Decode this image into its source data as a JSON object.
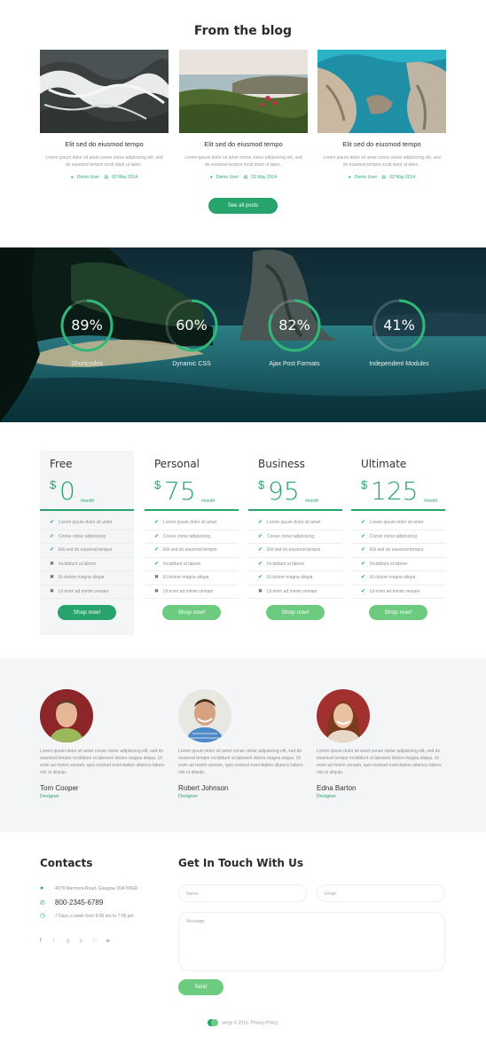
{
  "blog": {
    "title": "From the blog",
    "posts": [
      {
        "title": "Elit sed do eiusmod tempo",
        "text": "Lorem ipsum dolor sit amet conse ctetur adipisicing elit, sed do eiusmod tempor incid idunt ut labor..",
        "author": "Demo User",
        "date": "02 May 2014"
      },
      {
        "title": "Elit sed do eiusmod tempo",
        "text": "Lorem ipsum dolor sit amet conse ctetur adipisicing elit, sed do eiusmod tempor incid idunt ut labor..",
        "author": "Demo User",
        "date": "02 May 2014"
      },
      {
        "title": "Elit sed do eiusmod tempo",
        "text": "Lorem ipsum dolor sit amet conse ctetur adipisicing elit, sed do eiusmod tempor incid idunt ut labor..",
        "author": "Demo User",
        "date": "02 May 2014"
      }
    ],
    "see_all": "See all posts"
  },
  "stats": [
    {
      "value": "89%",
      "label": "Shortcodes",
      "percent": 89
    },
    {
      "value": "60%",
      "label": "Dynamic CSS",
      "percent": 60
    },
    {
      "value": "82%",
      "label": "Ajax Post Formats",
      "percent": 82
    },
    {
      "value": "41%",
      "label": "Independent Modules",
      "percent": 41
    }
  ],
  "pricing": {
    "currency": "$",
    "per": "/month",
    "button": "Shop now!",
    "plans": [
      {
        "name": "Free",
        "price": "0",
        "features": [
          {
            "text": "Lorem ipsum dolor sit amet",
            "included": true
          },
          {
            "text": "Conse ctetur adipisicing",
            "included": true
          },
          {
            "text": "Elit sed do eiusmod tempor",
            "included": true
          },
          {
            "text": "Incididunt ut labore",
            "included": false
          },
          {
            "text": "Et dolore magna aliqua",
            "included": false
          },
          {
            "text": "Ut enim ad minim veniam",
            "included": false
          }
        ]
      },
      {
        "name": "Personal",
        "price": "75",
        "features": [
          {
            "text": "Lorem ipsum dolor sit amet",
            "included": true
          },
          {
            "text": "Conse ctetur adipisicing",
            "included": true
          },
          {
            "text": "Elit sed do eiusmod tempor",
            "included": true
          },
          {
            "text": "Incididunt ut labore",
            "included": true
          },
          {
            "text": "Et dolore magna aliqua",
            "included": false
          },
          {
            "text": "Ut enim ad minim veniam",
            "included": false
          }
        ]
      },
      {
        "name": "Business",
        "price": "95",
        "features": [
          {
            "text": "Lorem ipsum dolor sit amet",
            "included": true
          },
          {
            "text": "Conse ctetur adipisicing",
            "included": true
          },
          {
            "text": "Elit sed do eiusmod tempor",
            "included": true
          },
          {
            "text": "Incididunt ut labore",
            "included": true
          },
          {
            "text": "Et dolore magna aliqua",
            "included": true
          },
          {
            "text": "Ut enim ad minim veniam",
            "included": false
          }
        ]
      },
      {
        "name": "Ultimate",
        "price": "125",
        "features": [
          {
            "text": "Lorem ipsum dolor sit amet",
            "included": true
          },
          {
            "text": "Conse ctetur adipisicing",
            "included": true
          },
          {
            "text": "Elit sed do eiusmod tempor",
            "included": true
          },
          {
            "text": "Incididunt ut labore",
            "included": true
          },
          {
            "text": "Et dolore magna aliqua",
            "included": true
          },
          {
            "text": "Ut enim ad minim veniam",
            "included": true
          }
        ]
      }
    ]
  },
  "team": [
    {
      "name": "Tom Cooper",
      "role": "Designer",
      "text": "Lorem ipsum dolor sit amet conse ctetur adipisicing elit, sed do eiusmod tempor incididunt ut laboreet dolore magna aliqua. Ut enim ad minim veniam, quis nostrud exercitation ullamco labors nisi ut aliquip."
    },
    {
      "name": "Robert Johnson",
      "role": "Designer",
      "text": "Lorem ipsum dolor sit amet conse ctetur adipisicing elit, sed do eiusmod tempor incididunt ut laboreet dolore magna aliqua. Ut enim ad minim veniam, quis nostrud exercitation ullamco labors nisi ut aliquip."
    },
    {
      "name": "Edna Barton",
      "role": "Designer",
      "text": "Lorem ipsum dolor sit amet conse ctetur adipisicing elit, sed do eiusmod tempor incididunt ut laboreet dolore magna aliqua. Ut enim ad minim veniam, quis nostrud exercitation ullamco labors nisi ut aliquip."
    }
  ],
  "contacts": {
    "title": "Contacts",
    "address": "4578 Marmora Road, Glasgow D04 89GR",
    "phone": "800-2345-6789",
    "hours": "7 Days a week from 9:00 am to 7:00 pm"
  },
  "form": {
    "title": "Get In Touch With Us",
    "name_placeholder": "Name:",
    "email_placeholder": "Email:",
    "message_placeholder": "Message:",
    "send": "Send"
  },
  "footer": {
    "text": "wegy © 2015. Privacy Policy"
  },
  "colors": {
    "accent": "#26a46c",
    "accent_light": "#6ccb7f",
    "ring_track": "rgba(255,255,255,0.18)"
  }
}
